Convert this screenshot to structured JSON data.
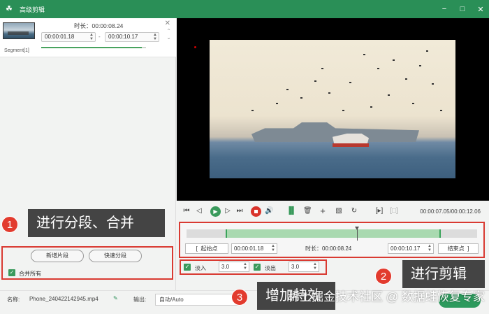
{
  "window": {
    "title": "高级剪辑",
    "icon": "frog-logo-icon"
  },
  "segment": {
    "duration_text": "时长：00:00:08.24",
    "start_time": "00:00:01.18",
    "end_time": "00:00:10.17",
    "dash": "-",
    "label": "Segment[1]",
    "progress": 0.96
  },
  "left_actions": {
    "new_segment": "新增片段",
    "quick_split": "快速分段",
    "merge_all": "合并所有",
    "merge_all_checked": true
  },
  "callouts": {
    "c1_num": "1",
    "c1_text": "进行分段、合并",
    "c2_num": "2",
    "c2_text": "进行剪辑",
    "c3_num": "3",
    "c3_text": "增加特效"
  },
  "playback": {
    "time_readout": "00:00:07.05/00:00:12.06",
    "play_icon": "▶"
  },
  "timeline": {
    "selection_start_fraction": 0.135,
    "selection_end_fraction": 0.875,
    "playhead_fraction": 0.587,
    "start_point_label": "起始点",
    "start_time": "00:00:01.18",
    "duration_text": "时长：00:00:08.24",
    "end_time": "00:00:10.17",
    "end_point_label": "结束点",
    "left_bracket": "[",
    "right_bracket": "]"
  },
  "effects": {
    "fade_in_label": "淡入",
    "fade_in_value": "3.0",
    "fade_in_checked": true,
    "fade_out_label": "淡出",
    "fade_out_value": "3.0",
    "fade_out_checked": true
  },
  "bottom": {
    "name_label": "名称:",
    "file_name": "Phone_240422142945.mp4",
    "output_label": "输出:",
    "output_value": "自动/Auto"
  },
  "watermark": "稀土掘金技术社区 @ 数据蛙恢复专家",
  "colors": {
    "accent": "#2a8f57",
    "callout_red": "#e23b2e",
    "box_red": "#d93a32"
  }
}
